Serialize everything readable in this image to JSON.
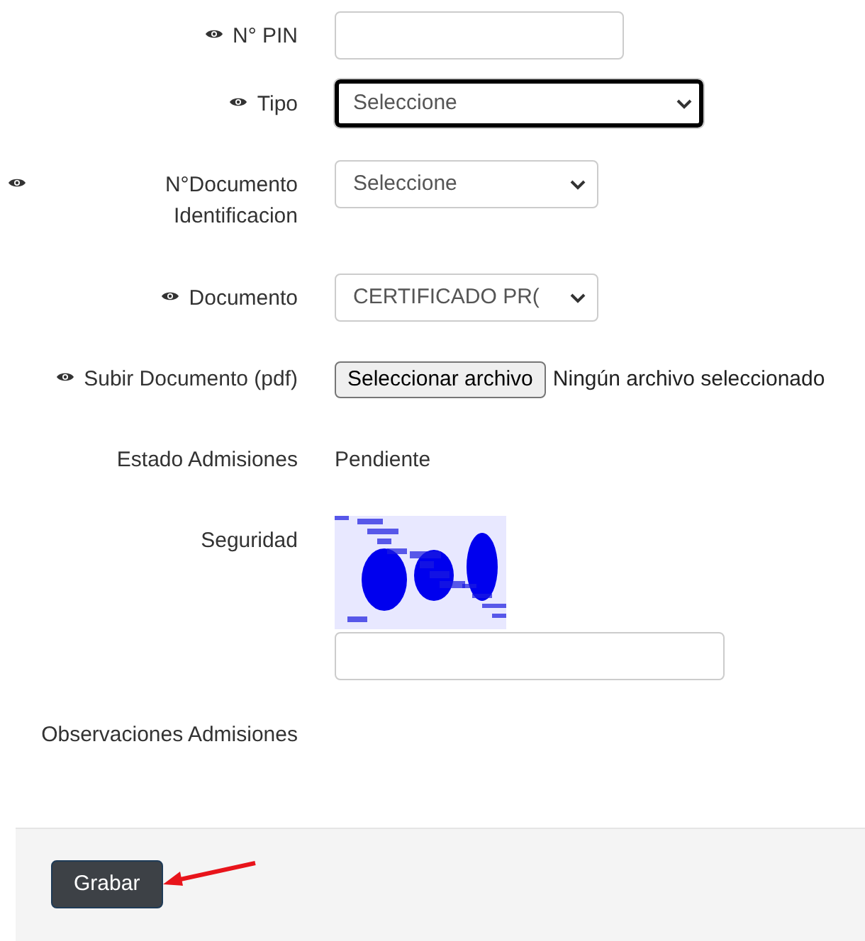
{
  "fields": [
    {
      "kind": "text",
      "label": "N° PIN",
      "eye_icon": true
    },
    {
      "kind": "select",
      "label": "Tipo",
      "eye_icon": true,
      "value": "Seleccione",
      "focused": true
    },
    {
      "kind": "select",
      "label": "N°Documento Identificacion",
      "eye_icon": true,
      "value": "Seleccione",
      "focused": false
    },
    {
      "kind": "select",
      "label": "Documento",
      "eye_icon": true,
      "value": "CERTIFICADO PR(",
      "focused": false
    },
    {
      "kind": "file",
      "label": "Subir Documento (pdf)",
      "eye_icon": true,
      "button": "Seleccionar archivo",
      "status": "Ningún archivo seleccionado"
    },
    {
      "kind": "static",
      "label": "Estado Admisiones",
      "eye_icon": false,
      "value": "Pendiente"
    },
    {
      "kind": "captcha",
      "label": "Seguridad",
      "eye_icon": false
    },
    {
      "kind": "empty",
      "label": "Observaciones Admisiones",
      "eye_icon": false
    }
  ],
  "footer": {
    "button": "Grabar",
    "arrow": true
  }
}
